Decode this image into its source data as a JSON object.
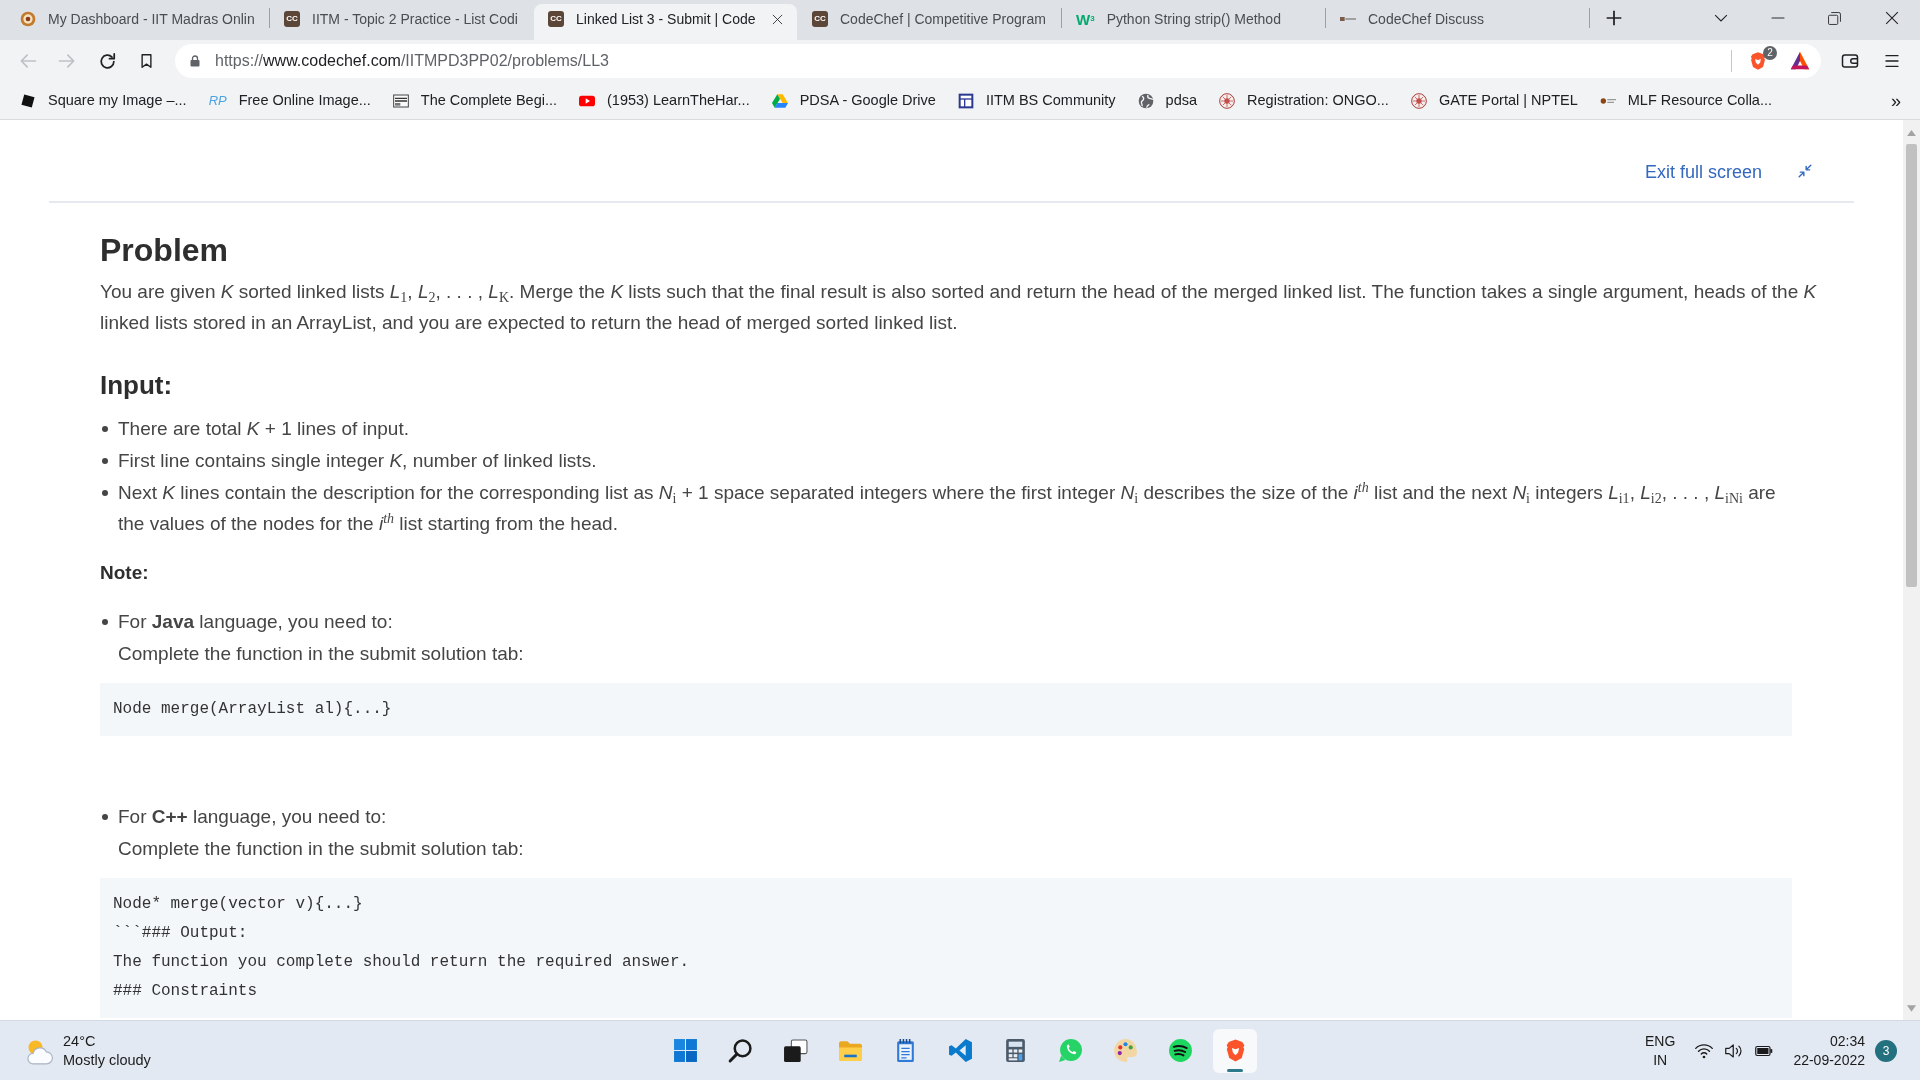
{
  "browser": {
    "tabs": [
      {
        "title": "My Dashboard - IIT Madras Onlin",
        "selected": false
      },
      {
        "title": "IITM - Topic 2 Practice - List Codi",
        "selected": false,
        "favicon": {
          "kind": "tile",
          "text": "CC"
        }
      },
      {
        "title": "Linked List 3 - Submit | Code",
        "selected": true,
        "favicon": {
          "kind": "tile",
          "text": "CC"
        }
      },
      {
        "title": "CodeChef | Competitive Program",
        "selected": false,
        "favicon": {
          "kind": "tile",
          "text": "CC"
        }
      },
      {
        "title": "Python String strip() Method",
        "selected": false,
        "favicon": {
          "kind": "wordmark",
          "text": "W$^{3}$"
        }
      },
      {
        "title": "CodeChef Discuss",
        "selected": false
      }
    ],
    "toolbar": {
      "back": {
        "disabled": true
      },
      "forward": {
        "disabled": true
      },
      "url": {
        "scheme": "https://",
        "host": "www.codechef.com",
        "path": "/IITMPD3PP02/problems/LL3"
      },
      "shields_count": "2"
    },
    "bookmarks": [
      {
        "label": "Square my Image –..."
      },
      {
        "label": "Free Online Image...",
        "icon_text": "RP"
      },
      {
        "label": "The Complete Begi..."
      },
      {
        "label": "(1953) LearnTheHar..."
      },
      {
        "label": "PDSA - Google Drive"
      },
      {
        "label": "IITM BS Community"
      },
      {
        "label": "pdsa"
      },
      {
        "label": "Registration: ONGO..."
      },
      {
        "label": "GATE Portal | NPTEL"
      },
      {
        "label": "MLF Resource Colla..."
      }
    ],
    "bookmarks_overflow": "»"
  },
  "page": {
    "exit_full_screen": "Exit full screen",
    "problem": {
      "heading": "Problem",
      "paragraph": "You are given *K* sorted linked lists *L*$_{1}$, *L*$_{2}$, . . . , *L*$_{K}$. Merge the *K* lists such that the final result is also sorted and return the head of the merged linked list. The function takes a single argument, heads of the *K* linked lists stored in an ArrayList, and you are expected to return the head of merged sorted linked list."
    },
    "input": {
      "heading": "Input:",
      "items": [
        "There are total *K* + 1 lines of input.",
        "First line contains single integer *K*, number of linked lists.",
        "Next *K* lines contain the description for the corresponding list as *N*$_{i}$ + 1 space separated integers where the first integer *N*$_{i}$ describes the size of the *i*$^{th}$ list and the next *N*$_{i}$ integers *L*$_{i1}$, *L*$_{i2}$, . . . , *L*$_{iNi}$ are the values of the nodes for the *i*$^{th}$ list starting from the head."
      ]
    },
    "note": {
      "heading": "Note:",
      "languages": [
        {
          "intro": "For **Java** language, you need to:",
          "instruction": "Complete the function in the submit solution tab:",
          "code": [
            "Node merge(ArrayList al){...}"
          ]
        },
        {
          "intro": "For **C++** language, you need to:",
          "instruction": "Complete the function in the submit solution tab:",
          "code": [
            "Node* merge(vector v){...}",
            "```### Output:",
            "The function you complete should return the required answer.",
            "### Constraints"
          ]
        }
      ]
    }
  },
  "taskbar": {
    "weather": {
      "temperature": "24°C",
      "condition": "Mostly cloudy"
    },
    "apps": [
      {
        "selected": false
      },
      {
        "selected": false
      },
      {
        "selected": false
      },
      {
        "selected": false
      },
      {
        "selected": false
      },
      {
        "selected": false
      },
      {
        "selected": false
      },
      {
        "selected": false
      },
      {
        "selected": false
      },
      {
        "selected": false
      },
      {
        "selected": true
      }
    ],
    "language": {
      "code": "ENG",
      "region": "IN"
    },
    "clock": {
      "time": "02:34",
      "date": "22-09-2022"
    },
    "notifications": "3"
  }
}
